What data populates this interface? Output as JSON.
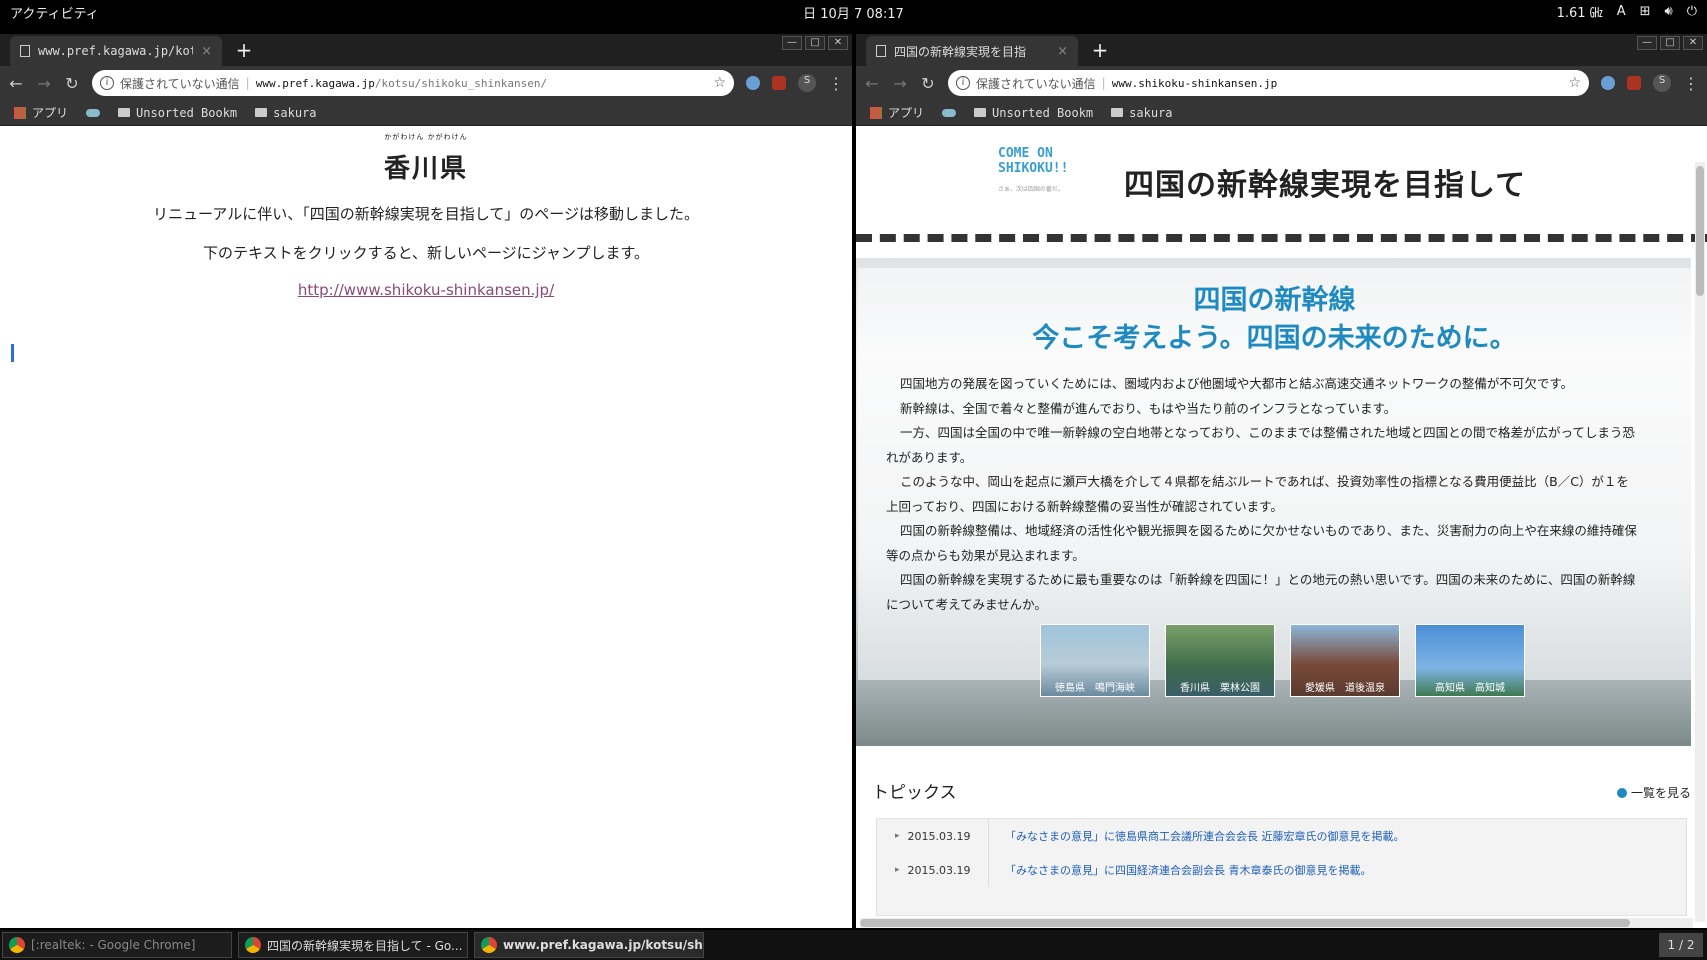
{
  "topbar": {
    "activities": "アクティビティ",
    "clock": "日 10月 7 08:17",
    "freq": "1.61 ㎓",
    "input": "A"
  },
  "left_window": {
    "tab_title": "www.pref.kagawa.jp/kot",
    "security": "保護されていない通信",
    "url_host": "www.pref.kagawa.jp",
    "url_path": "/kotsu/shikoku_shinkansen/",
    "bookmarks": [
      "アプリ",
      "Unsorted Bookm",
      "sakura"
    ],
    "page": {
      "logo_ruby": "かがわけん かがわけん",
      "logo": "香川県",
      "line1": "リニューアルに伴い、「四国の新幹線実現を目指して」のページは移動しました。",
      "line2": "下のテキストをクリックすると、新しいページにジャンプします。",
      "link": "http://www.shikoku-shinkansen.jp/"
    }
  },
  "right_window": {
    "tab_title": "四国の新幹線実現を目指",
    "security": "保護されていない通信",
    "url_host": "www.shikoku-shinkansen.jp",
    "bookmarks": [
      "アプリ",
      "Unsorted Bookm",
      "sakura"
    ],
    "page": {
      "logo_line1": "COME ON",
      "logo_line2": "SHIKOKU!!",
      "logo_small": "さぁ、次は四国の番だ。",
      "title": "四国の新幹線実現を目指して",
      "hero_title1": "四国の新幹線",
      "hero_title2": "今こそ考えよう。四国の未来のために。",
      "paragraphs": [
        "四国地方の発展を図っていくためには、圏域内および他圏域や大都市と結ぶ高速交通ネットワークの整備が不可欠です。",
        "新幹線は、全国で着々と整備が進んでおり、もはや当たり前のインフラとなっています。",
        "一方、四国は全国の中で唯一新幹線の空白地帯となっており、このままでは整備された地域と四国との間で格差が広がってしまう恐",
        "れがあります。",
        "このような中、岡山を起点に瀬戸大橋を介して４県都を結ぶルートであれば、投資効率性の指標となる費用便益比（B／C）が１を",
        "上回っており、四国における新幹線整備の妥当性が確認されています。",
        "四国の新幹線整備は、地域経済の活性化や観光振興を図るために欠かせないものであり、また、災害耐力の向上や在来線の維持確保",
        "等の点からも効果が見込まれます。",
        "四国の新幹線を実現するために最も重要なのは「新幹線を四国に！」との地元の熱い思いです。四国の未来のために、四国の新幹線",
        "について考えてみませんか。"
      ],
      "thumbs": [
        "徳島県　鳴門海峡",
        "香川県　栗林公園",
        "愛媛県　道後温泉",
        "高知県　高知城"
      ],
      "topics_title": "トピックス",
      "topics_more": "一覧を見る",
      "topics": [
        {
          "date": "2015.03.19",
          "text": "「みなさまの意見」に徳島県商工会議所連合会会長 近藤宏章氏の御意見を掲載。"
        },
        {
          "date": "2015.03.19",
          "text": "「みなさまの意見」に四国経済連合会副会長 青木章泰氏の御意見を掲載。"
        }
      ]
    }
  },
  "taskbar": {
    "items": [
      "[:realtek: - Google Chrome]",
      "四国の新幹線実現を目指して - Go...",
      "www.pref.kagawa.jp/kotsu/shiko..."
    ],
    "pager": "1 / 2"
  }
}
